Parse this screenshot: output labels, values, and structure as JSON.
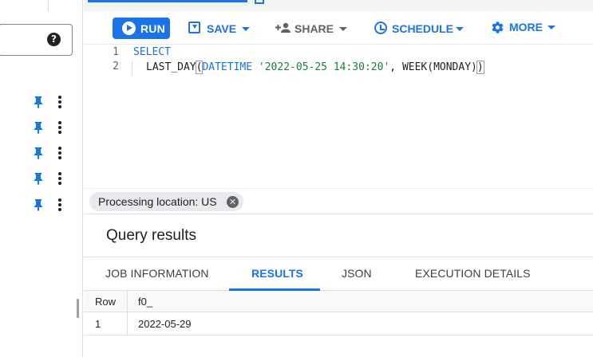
{
  "left_panel": {
    "help_icon_glyph": "?",
    "resource_rows": [
      {
        "pin_icon": "pin-icon",
        "menu_icon": "more-vert-icon"
      },
      {
        "pin_icon": "pin-icon",
        "menu_icon": "more-vert-icon"
      },
      {
        "pin_icon": "pin-icon",
        "menu_icon": "more-vert-icon"
      },
      {
        "pin_icon": "pin-icon",
        "menu_icon": "more-vert-icon"
      },
      {
        "pin_icon": "pin-icon",
        "menu_icon": "more-vert-icon"
      }
    ]
  },
  "toolbar": {
    "run_label": "RUN",
    "save_label": "SAVE",
    "share_label": "SHARE",
    "schedule_label": "SCHEDULE",
    "more_label": "MORE"
  },
  "editor": {
    "lines": [
      {
        "number": "1"
      },
      {
        "number": "2"
      }
    ],
    "line1_keyword": "SELECT",
    "line2_fn": "LAST_DAY",
    "line2_open": "(",
    "line2_type": "DATETIME",
    "line2_string": "'2022-05-25 14:30:20'",
    "line2_comma": ", ",
    "line2_arg": "WEEK(MONDAY)",
    "line2_close": ")"
  },
  "processing_location": {
    "label": "Processing location: US",
    "close_glyph": "✕"
  },
  "results": {
    "title": "Query results",
    "tabs": [
      {
        "label": "JOB INFORMATION",
        "active": false
      },
      {
        "label": "RESULTS",
        "active": true
      },
      {
        "label": "JSON",
        "active": false
      },
      {
        "label": "EXECUTION DETAILS",
        "active": false
      }
    ],
    "columns": [
      "Row",
      "f0_"
    ],
    "rows": [
      [
        "1",
        "2022-05-29"
      ]
    ]
  },
  "colors": {
    "accent": "#1a73e8",
    "string": "#188038",
    "icon_grey": "#5f6368"
  }
}
